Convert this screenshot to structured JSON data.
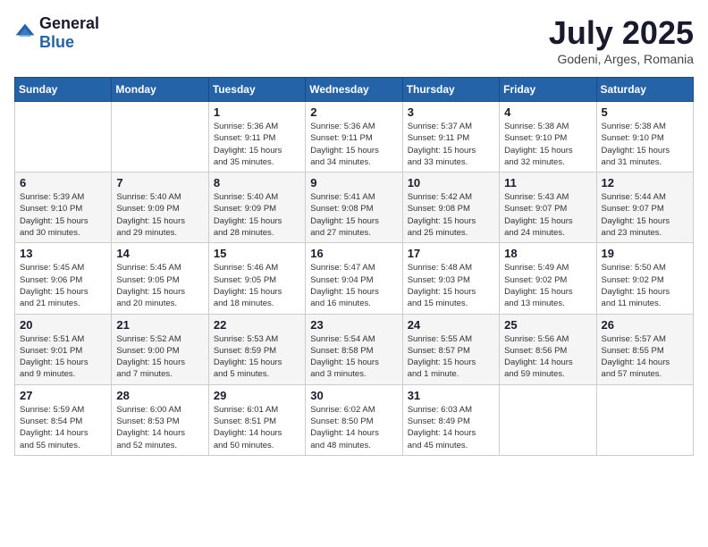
{
  "logo": {
    "general": "General",
    "blue": "Blue"
  },
  "title": {
    "month_year": "July 2025",
    "location": "Godeni, Arges, Romania"
  },
  "weekdays": [
    "Sunday",
    "Monday",
    "Tuesday",
    "Wednesday",
    "Thursday",
    "Friday",
    "Saturday"
  ],
  "weeks": [
    [
      {
        "day": "",
        "info": ""
      },
      {
        "day": "",
        "info": ""
      },
      {
        "day": "1",
        "info": "Sunrise: 5:36 AM\nSunset: 9:11 PM\nDaylight: 15 hours\nand 35 minutes."
      },
      {
        "day": "2",
        "info": "Sunrise: 5:36 AM\nSunset: 9:11 PM\nDaylight: 15 hours\nand 34 minutes."
      },
      {
        "day": "3",
        "info": "Sunrise: 5:37 AM\nSunset: 9:11 PM\nDaylight: 15 hours\nand 33 minutes."
      },
      {
        "day": "4",
        "info": "Sunrise: 5:38 AM\nSunset: 9:10 PM\nDaylight: 15 hours\nand 32 minutes."
      },
      {
        "day": "5",
        "info": "Sunrise: 5:38 AM\nSunset: 9:10 PM\nDaylight: 15 hours\nand 31 minutes."
      }
    ],
    [
      {
        "day": "6",
        "info": "Sunrise: 5:39 AM\nSunset: 9:10 PM\nDaylight: 15 hours\nand 30 minutes."
      },
      {
        "day": "7",
        "info": "Sunrise: 5:40 AM\nSunset: 9:09 PM\nDaylight: 15 hours\nand 29 minutes."
      },
      {
        "day": "8",
        "info": "Sunrise: 5:40 AM\nSunset: 9:09 PM\nDaylight: 15 hours\nand 28 minutes."
      },
      {
        "day": "9",
        "info": "Sunrise: 5:41 AM\nSunset: 9:08 PM\nDaylight: 15 hours\nand 27 minutes."
      },
      {
        "day": "10",
        "info": "Sunrise: 5:42 AM\nSunset: 9:08 PM\nDaylight: 15 hours\nand 25 minutes."
      },
      {
        "day": "11",
        "info": "Sunrise: 5:43 AM\nSunset: 9:07 PM\nDaylight: 15 hours\nand 24 minutes."
      },
      {
        "day": "12",
        "info": "Sunrise: 5:44 AM\nSunset: 9:07 PM\nDaylight: 15 hours\nand 23 minutes."
      }
    ],
    [
      {
        "day": "13",
        "info": "Sunrise: 5:45 AM\nSunset: 9:06 PM\nDaylight: 15 hours\nand 21 minutes."
      },
      {
        "day": "14",
        "info": "Sunrise: 5:45 AM\nSunset: 9:05 PM\nDaylight: 15 hours\nand 20 minutes."
      },
      {
        "day": "15",
        "info": "Sunrise: 5:46 AM\nSunset: 9:05 PM\nDaylight: 15 hours\nand 18 minutes."
      },
      {
        "day": "16",
        "info": "Sunrise: 5:47 AM\nSunset: 9:04 PM\nDaylight: 15 hours\nand 16 minutes."
      },
      {
        "day": "17",
        "info": "Sunrise: 5:48 AM\nSunset: 9:03 PM\nDaylight: 15 hours\nand 15 minutes."
      },
      {
        "day": "18",
        "info": "Sunrise: 5:49 AM\nSunset: 9:02 PM\nDaylight: 15 hours\nand 13 minutes."
      },
      {
        "day": "19",
        "info": "Sunrise: 5:50 AM\nSunset: 9:02 PM\nDaylight: 15 hours\nand 11 minutes."
      }
    ],
    [
      {
        "day": "20",
        "info": "Sunrise: 5:51 AM\nSunset: 9:01 PM\nDaylight: 15 hours\nand 9 minutes."
      },
      {
        "day": "21",
        "info": "Sunrise: 5:52 AM\nSunset: 9:00 PM\nDaylight: 15 hours\nand 7 minutes."
      },
      {
        "day": "22",
        "info": "Sunrise: 5:53 AM\nSunset: 8:59 PM\nDaylight: 15 hours\nand 5 minutes."
      },
      {
        "day": "23",
        "info": "Sunrise: 5:54 AM\nSunset: 8:58 PM\nDaylight: 15 hours\nand 3 minutes."
      },
      {
        "day": "24",
        "info": "Sunrise: 5:55 AM\nSunset: 8:57 PM\nDaylight: 15 hours\nand 1 minute."
      },
      {
        "day": "25",
        "info": "Sunrise: 5:56 AM\nSunset: 8:56 PM\nDaylight: 14 hours\nand 59 minutes."
      },
      {
        "day": "26",
        "info": "Sunrise: 5:57 AM\nSunset: 8:55 PM\nDaylight: 14 hours\nand 57 minutes."
      }
    ],
    [
      {
        "day": "27",
        "info": "Sunrise: 5:59 AM\nSunset: 8:54 PM\nDaylight: 14 hours\nand 55 minutes."
      },
      {
        "day": "28",
        "info": "Sunrise: 6:00 AM\nSunset: 8:53 PM\nDaylight: 14 hours\nand 52 minutes."
      },
      {
        "day": "29",
        "info": "Sunrise: 6:01 AM\nSunset: 8:51 PM\nDaylight: 14 hours\nand 50 minutes."
      },
      {
        "day": "30",
        "info": "Sunrise: 6:02 AM\nSunset: 8:50 PM\nDaylight: 14 hours\nand 48 minutes."
      },
      {
        "day": "31",
        "info": "Sunrise: 6:03 AM\nSunset: 8:49 PM\nDaylight: 14 hours\nand 45 minutes."
      },
      {
        "day": "",
        "info": ""
      },
      {
        "day": "",
        "info": ""
      }
    ]
  ]
}
